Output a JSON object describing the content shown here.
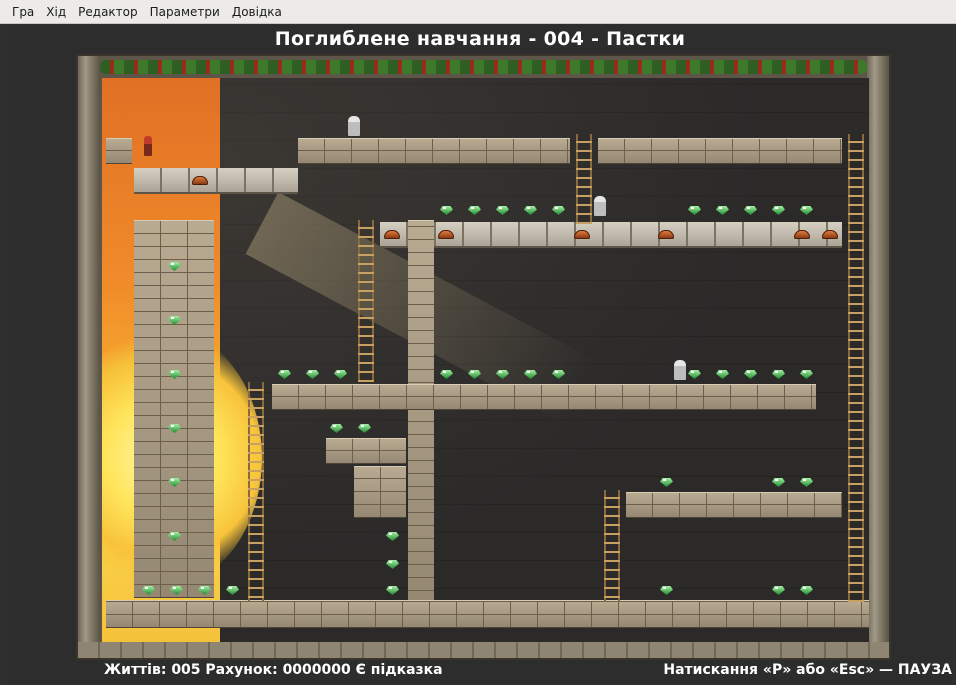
{
  "menu": {
    "game": "Гра",
    "move": "Хід",
    "editor": "Редактор",
    "settings": "Параметри",
    "help": "Довідка"
  },
  "level": {
    "title": "Поглиблене навчання - 004 - Пастки"
  },
  "status": {
    "lives_label": "Життів:",
    "lives": "005",
    "score_label": "Рахунок:",
    "score": "0000000",
    "hint": "Є підказка",
    "pause_hint": "Натискання «P» або «Esc» — ПАУЗА"
  },
  "colors": {
    "sunset": "#f08a2a",
    "brick": "#b9ab92",
    "gem": "#1e8a2e",
    "ladder": "#c7a062"
  }
}
